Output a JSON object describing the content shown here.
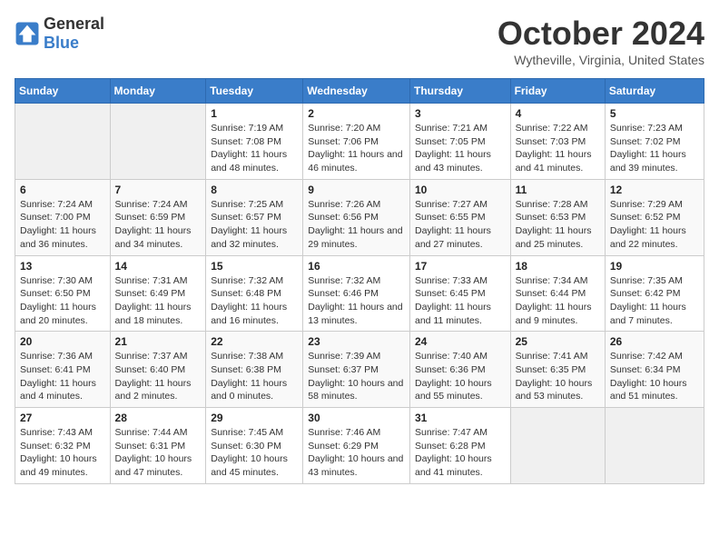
{
  "header": {
    "logo_general": "General",
    "logo_blue": "Blue",
    "title": "October 2024",
    "subtitle": "Wytheville, Virginia, United States"
  },
  "columns": [
    "Sunday",
    "Monday",
    "Tuesday",
    "Wednesday",
    "Thursday",
    "Friday",
    "Saturday"
  ],
  "weeks": [
    [
      {
        "day": "",
        "sunrise": "",
        "sunset": "",
        "daylight": ""
      },
      {
        "day": "",
        "sunrise": "",
        "sunset": "",
        "daylight": ""
      },
      {
        "day": "1",
        "sunrise": "Sunrise: 7:19 AM",
        "sunset": "Sunset: 7:08 PM",
        "daylight": "Daylight: 11 hours and 48 minutes."
      },
      {
        "day": "2",
        "sunrise": "Sunrise: 7:20 AM",
        "sunset": "Sunset: 7:06 PM",
        "daylight": "Daylight: 11 hours and 46 minutes."
      },
      {
        "day": "3",
        "sunrise": "Sunrise: 7:21 AM",
        "sunset": "Sunset: 7:05 PM",
        "daylight": "Daylight: 11 hours and 43 minutes."
      },
      {
        "day": "4",
        "sunrise": "Sunrise: 7:22 AM",
        "sunset": "Sunset: 7:03 PM",
        "daylight": "Daylight: 11 hours and 41 minutes."
      },
      {
        "day": "5",
        "sunrise": "Sunrise: 7:23 AM",
        "sunset": "Sunset: 7:02 PM",
        "daylight": "Daylight: 11 hours and 39 minutes."
      }
    ],
    [
      {
        "day": "6",
        "sunrise": "Sunrise: 7:24 AM",
        "sunset": "Sunset: 7:00 PM",
        "daylight": "Daylight: 11 hours and 36 minutes."
      },
      {
        "day": "7",
        "sunrise": "Sunrise: 7:24 AM",
        "sunset": "Sunset: 6:59 PM",
        "daylight": "Daylight: 11 hours and 34 minutes."
      },
      {
        "day": "8",
        "sunrise": "Sunrise: 7:25 AM",
        "sunset": "Sunset: 6:57 PM",
        "daylight": "Daylight: 11 hours and 32 minutes."
      },
      {
        "day": "9",
        "sunrise": "Sunrise: 7:26 AM",
        "sunset": "Sunset: 6:56 PM",
        "daylight": "Daylight: 11 hours and 29 minutes."
      },
      {
        "day": "10",
        "sunrise": "Sunrise: 7:27 AM",
        "sunset": "Sunset: 6:55 PM",
        "daylight": "Daylight: 11 hours and 27 minutes."
      },
      {
        "day": "11",
        "sunrise": "Sunrise: 7:28 AM",
        "sunset": "Sunset: 6:53 PM",
        "daylight": "Daylight: 11 hours and 25 minutes."
      },
      {
        "day": "12",
        "sunrise": "Sunrise: 7:29 AM",
        "sunset": "Sunset: 6:52 PM",
        "daylight": "Daylight: 11 hours and 22 minutes."
      }
    ],
    [
      {
        "day": "13",
        "sunrise": "Sunrise: 7:30 AM",
        "sunset": "Sunset: 6:50 PM",
        "daylight": "Daylight: 11 hours and 20 minutes."
      },
      {
        "day": "14",
        "sunrise": "Sunrise: 7:31 AM",
        "sunset": "Sunset: 6:49 PM",
        "daylight": "Daylight: 11 hours and 18 minutes."
      },
      {
        "day": "15",
        "sunrise": "Sunrise: 7:32 AM",
        "sunset": "Sunset: 6:48 PM",
        "daylight": "Daylight: 11 hours and 16 minutes."
      },
      {
        "day": "16",
        "sunrise": "Sunrise: 7:32 AM",
        "sunset": "Sunset: 6:46 PM",
        "daylight": "Daylight: 11 hours and 13 minutes."
      },
      {
        "day": "17",
        "sunrise": "Sunrise: 7:33 AM",
        "sunset": "Sunset: 6:45 PM",
        "daylight": "Daylight: 11 hours and 11 minutes."
      },
      {
        "day": "18",
        "sunrise": "Sunrise: 7:34 AM",
        "sunset": "Sunset: 6:44 PM",
        "daylight": "Daylight: 11 hours and 9 minutes."
      },
      {
        "day": "19",
        "sunrise": "Sunrise: 7:35 AM",
        "sunset": "Sunset: 6:42 PM",
        "daylight": "Daylight: 11 hours and 7 minutes."
      }
    ],
    [
      {
        "day": "20",
        "sunrise": "Sunrise: 7:36 AM",
        "sunset": "Sunset: 6:41 PM",
        "daylight": "Daylight: 11 hours and 4 minutes."
      },
      {
        "day": "21",
        "sunrise": "Sunrise: 7:37 AM",
        "sunset": "Sunset: 6:40 PM",
        "daylight": "Daylight: 11 hours and 2 minutes."
      },
      {
        "day": "22",
        "sunrise": "Sunrise: 7:38 AM",
        "sunset": "Sunset: 6:38 PM",
        "daylight": "Daylight: 11 hours and 0 minutes."
      },
      {
        "day": "23",
        "sunrise": "Sunrise: 7:39 AM",
        "sunset": "Sunset: 6:37 PM",
        "daylight": "Daylight: 10 hours and 58 minutes."
      },
      {
        "day": "24",
        "sunrise": "Sunrise: 7:40 AM",
        "sunset": "Sunset: 6:36 PM",
        "daylight": "Daylight: 10 hours and 55 minutes."
      },
      {
        "day": "25",
        "sunrise": "Sunrise: 7:41 AM",
        "sunset": "Sunset: 6:35 PM",
        "daylight": "Daylight: 10 hours and 53 minutes."
      },
      {
        "day": "26",
        "sunrise": "Sunrise: 7:42 AM",
        "sunset": "Sunset: 6:34 PM",
        "daylight": "Daylight: 10 hours and 51 minutes."
      }
    ],
    [
      {
        "day": "27",
        "sunrise": "Sunrise: 7:43 AM",
        "sunset": "Sunset: 6:32 PM",
        "daylight": "Daylight: 10 hours and 49 minutes."
      },
      {
        "day": "28",
        "sunrise": "Sunrise: 7:44 AM",
        "sunset": "Sunset: 6:31 PM",
        "daylight": "Daylight: 10 hours and 47 minutes."
      },
      {
        "day": "29",
        "sunrise": "Sunrise: 7:45 AM",
        "sunset": "Sunset: 6:30 PM",
        "daylight": "Daylight: 10 hours and 45 minutes."
      },
      {
        "day": "30",
        "sunrise": "Sunrise: 7:46 AM",
        "sunset": "Sunset: 6:29 PM",
        "daylight": "Daylight: 10 hours and 43 minutes."
      },
      {
        "day": "31",
        "sunrise": "Sunrise: 7:47 AM",
        "sunset": "Sunset: 6:28 PM",
        "daylight": "Daylight: 10 hours and 41 minutes."
      },
      {
        "day": "",
        "sunrise": "",
        "sunset": "",
        "daylight": ""
      },
      {
        "day": "",
        "sunrise": "",
        "sunset": "",
        "daylight": ""
      }
    ]
  ]
}
